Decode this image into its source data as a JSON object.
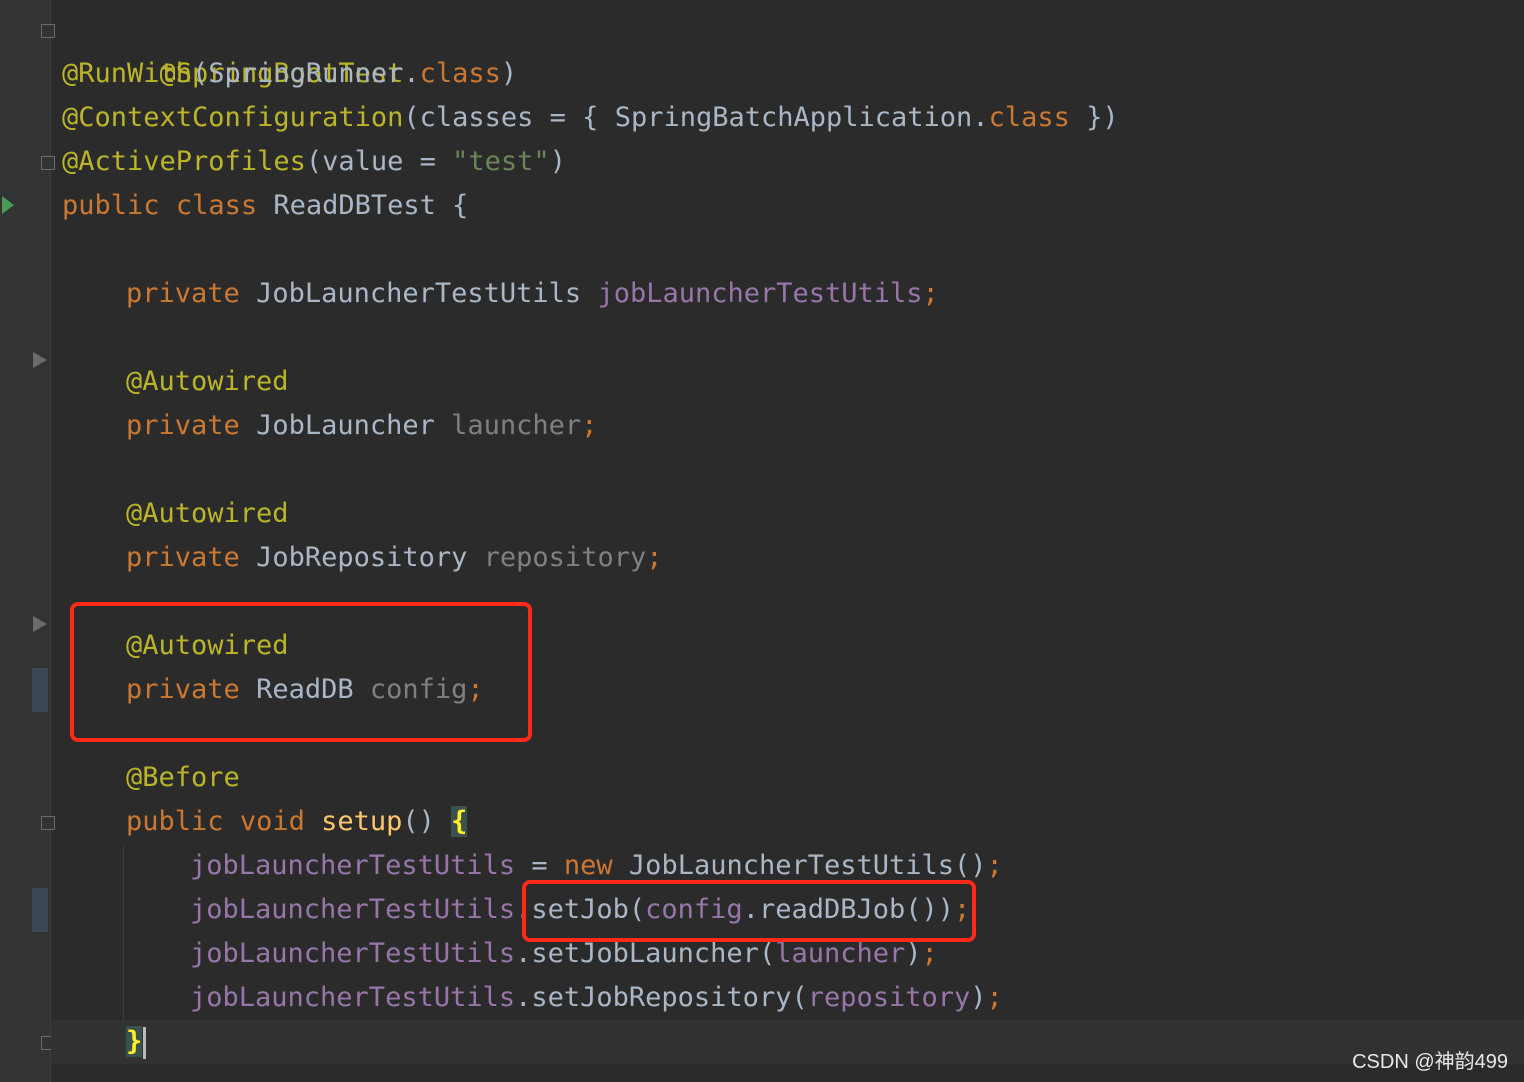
{
  "editor": {
    "lines": {
      "l1": {
        "ann": "@SpringBootTest"
      },
      "l2": {
        "ann": "@RunWith",
        "p1": "(SpringRunner.",
        "kw": "class",
        "p2": ")"
      },
      "l3": {
        "ann": "@ContextConfiguration",
        "p1": "(classes = { SpringBatchApplication.",
        "kw": "class",
        "p2": " })"
      },
      "l4": {
        "ann": "@ActiveProfiles",
        "p1": "(value = ",
        "str": "\"test\"",
        "p2": ")"
      },
      "l5": {
        "kw1": "public",
        "kw2": "class",
        "name": "ReadDBTest",
        "p": " {"
      },
      "l7": {
        "kw": "private",
        "type": "JobLauncherTestUtils",
        "field": "jobLauncherTestUtils",
        "semi": ";"
      },
      "l9": {
        "ann": "@Autowired"
      },
      "l10": {
        "kw": "private",
        "type": "JobLauncher",
        "field": "launcher",
        "semi": ";"
      },
      "l12": {
        "ann": "@Autowired"
      },
      "l13": {
        "kw": "private",
        "type": "JobRepository",
        "field": "repository",
        "semi": ";"
      },
      "l15": {
        "ann": "@Autowired"
      },
      "l16": {
        "kw": "private",
        "type": "ReadDB",
        "field": "config",
        "semi": ";"
      },
      "l18": {
        "ann": "@Before"
      },
      "l19": {
        "kw1": "public",
        "kw2": "void",
        "method": "setup",
        "p": "() ",
        "brace": "{"
      },
      "l20": {
        "field": "jobLauncherTestUtils",
        "p1": " = ",
        "kw": "new",
        "p2": " JobLauncherTestUtils()",
        "semi": ";"
      },
      "l21": {
        "field": "jobLauncherTestUtils",
        "p1": ".setJob(",
        "arg": "config",
        "p2": ".readDBJob())",
        "semi": ";"
      },
      "l22": {
        "field": "jobLauncherTestUtils",
        "p1": ".setJobLauncher(",
        "arg": "launcher",
        "p2": ")",
        "semi": ";"
      },
      "l23": {
        "field": "jobLauncherTestUtils",
        "p1": ".setJobRepository(",
        "arg": "repository",
        "p2": ")",
        "semi": ";"
      },
      "l24": {
        "brace": "}"
      }
    }
  },
  "watermark": "CSDN @神韵499",
  "colors": {
    "background": "#2b2b2b",
    "annotation": "#bbb529",
    "keyword": "#cc7832",
    "field": "#9876aa",
    "string": "#6a8759",
    "method": "#ffc66d",
    "highlight_box": "#ff2a1a"
  }
}
